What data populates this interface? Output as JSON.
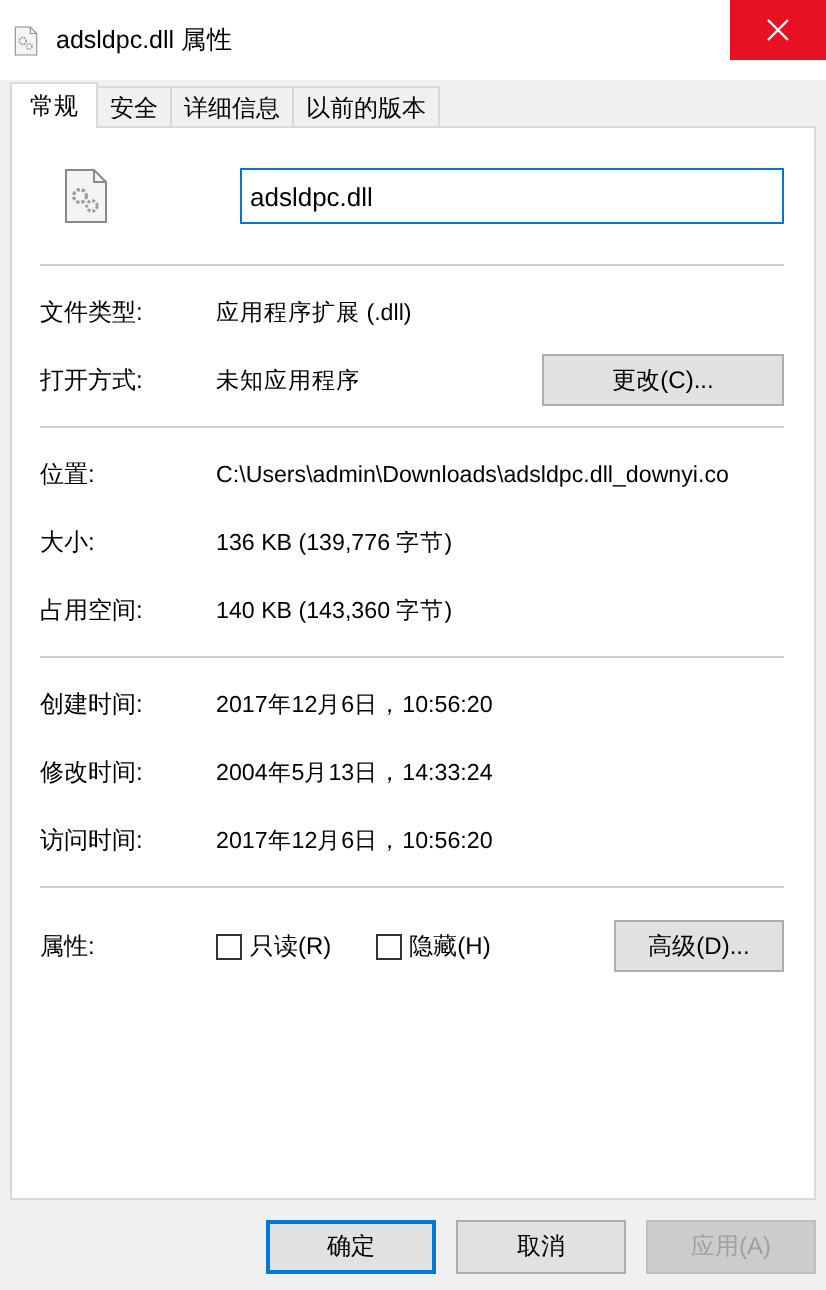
{
  "window": {
    "title": "adsldpc.dll 属性"
  },
  "tabs": [
    {
      "label": "常规",
      "selected": true
    },
    {
      "label": "安全",
      "selected": false
    },
    {
      "label": "详细信息",
      "selected": false
    },
    {
      "label": "以前的版本",
      "selected": false
    }
  ],
  "file_name": {
    "value": "adsldpc.dll"
  },
  "sections": [
    {
      "rows": [
        {
          "label": "文件类型:",
          "value": "应用程序扩展 (.dll)"
        },
        {
          "label": "打开方式:",
          "value": "未知应用程序",
          "button": "更改(C)..."
        }
      ]
    },
    {
      "rows": [
        {
          "label": "位置:",
          "value": "C:\\Users\\admin\\Downloads\\adsldpc.dll_downyi.co"
        },
        {
          "label": "大小:",
          "value": "136 KB (139,776 字节)"
        },
        {
          "label": "占用空间:",
          "value": "140 KB (143,360 字节)"
        }
      ]
    },
    {
      "rows": [
        {
          "label": "创建时间:",
          "value": "2017年12月6日，10:56:20"
        },
        {
          "label": "修改时间:",
          "value": "2004年5月13日，14:33:24"
        },
        {
          "label": "访问时间:",
          "value": "2017年12月6日，10:56:20"
        }
      ]
    }
  ],
  "attributes": {
    "label": "属性:",
    "checkboxes": [
      {
        "label": "只读(R)",
        "checked": false
      },
      {
        "label": "隐藏(H)",
        "checked": false
      }
    ],
    "button": "高级(D)..."
  },
  "buttons": [
    {
      "label": "确定",
      "default": true,
      "disabled": false
    },
    {
      "label": "取消",
      "default": false,
      "disabled": false
    },
    {
      "label": "应用(A)",
      "default": false,
      "disabled": true
    }
  ]
}
